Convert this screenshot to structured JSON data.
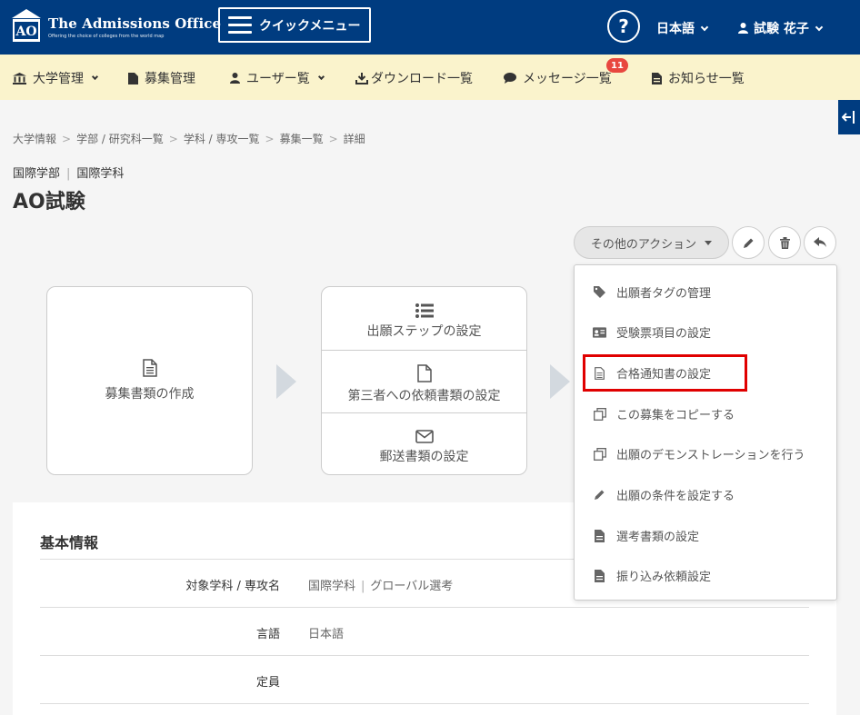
{
  "header": {
    "logo_mark": "AO",
    "app_name": "The Admissions Office",
    "tagline": "Offering the choice of colleges from the world map",
    "quick_menu": "クイックメニュー",
    "help": "?",
    "language": "日本語",
    "user": "試験 花子"
  },
  "nav": {
    "items": [
      {
        "label": "大学管理"
      },
      {
        "label": "募集管理"
      },
      {
        "label": "ユーザー覧"
      },
      {
        "label": "ダウンロード一覧"
      },
      {
        "label": "メッセージ一覧"
      },
      {
        "label": "お知らせ一覧"
      }
    ],
    "message_badge": "11"
  },
  "breadcrumb": [
    "大学情報",
    "学部 / 研究科一覧",
    "学科 / 専攻一覧",
    "募集一覧",
    "詳細"
  ],
  "breadcrumb_sep": ">",
  "department": {
    "faculty": "国際学部",
    "sep": "|",
    "subject": "国際学科"
  },
  "page_title": "AO試験",
  "actions": {
    "other": "その他のアクション"
  },
  "flow": {
    "box1_label": "募集書類の作成",
    "box2_labels": [
      "出願ステップの設定",
      "第三者への依頼書類の設定",
      "郵送書類の設定"
    ]
  },
  "basic_info": {
    "title": "基本情報",
    "rows": [
      {
        "label": "対象学科 / 専攻名",
        "value_a": "国際学科",
        "sep": "|",
        "value_b": "グローバル選考"
      },
      {
        "label": "言語",
        "value": "日本語"
      },
      {
        "label": "定員",
        "value": ""
      }
    ]
  },
  "dropdown": {
    "items": [
      {
        "label": "出願者タグの管理",
        "icon": "tag-icon"
      },
      {
        "label": "受験票項目の設定",
        "icon": "id-card-icon"
      },
      {
        "label": "合格通知書の設定",
        "icon": "document-icon"
      },
      {
        "label": "この募集をコピーする",
        "icon": "copy-icon"
      },
      {
        "label": "出願のデモンストレーションを行う",
        "icon": "copy-icon"
      },
      {
        "label": "出願の条件を設定する",
        "icon": "pencil-icon"
      },
      {
        "label": "選考書類の設定",
        "icon": "file-icon"
      },
      {
        "label": "振り込み依頼設定",
        "icon": "file-icon"
      }
    ]
  },
  "colors": {
    "header": "#003c80",
    "nav": "#faf3cc",
    "badge": "#e8473f",
    "highlight": "#e00000"
  }
}
